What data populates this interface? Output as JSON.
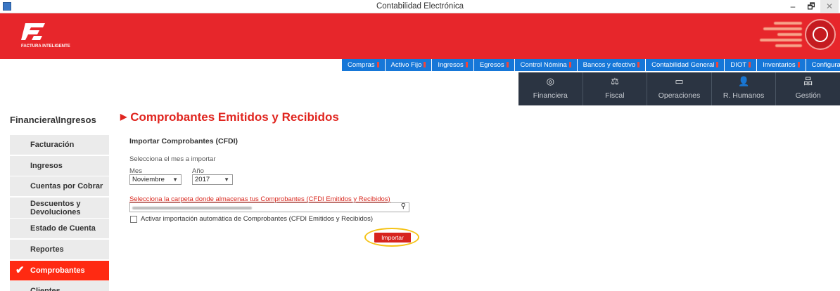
{
  "window": {
    "title": "Contabilidad Electrónica",
    "minimize": "–",
    "maximize": "🗗",
    "close": "✕"
  },
  "brand": {
    "logo_text": "FACTURA INTELIGENTE"
  },
  "topnav": [
    {
      "label": "Compras",
      "pinned": true
    },
    {
      "label": "Activo Fijo",
      "pinned": true
    },
    {
      "label": "Ingresos",
      "pinned": true
    },
    {
      "label": "Egresos",
      "pinned": true
    },
    {
      "label": "Control Nómina",
      "pinned": true
    },
    {
      "label": "Bancos y efectivo",
      "pinned": true
    },
    {
      "label": "Contabilidad General",
      "pinned": true
    },
    {
      "label": "DIOT",
      "pinned": true
    },
    {
      "label": "Inventarios",
      "pinned": true
    },
    {
      "label": "Configuración",
      "pinned": false
    }
  ],
  "modules": [
    {
      "label": "Financiera",
      "icon": "coins-icon",
      "glyph": "◎"
    },
    {
      "label": "Fiscal",
      "icon": "scales-icon",
      "glyph": "⚖"
    },
    {
      "label": "Operaciones",
      "icon": "monitor-icon",
      "glyph": "▭"
    },
    {
      "label": "R. Humanos",
      "icon": "person-icon",
      "glyph": "👤"
    },
    {
      "label": "Gestión",
      "icon": "org-chart-icon",
      "glyph": "品"
    }
  ],
  "breadcrumb": "Financiera\\Ingresos",
  "sidebar": [
    {
      "label": "Facturación"
    },
    {
      "label": "Ingresos"
    },
    {
      "label": "Cuentas por Cobrar"
    },
    {
      "label": "Descuentos y Devoluciones"
    },
    {
      "label": "Estado de Cuenta"
    },
    {
      "label": "Reportes"
    },
    {
      "label": "Comprobantes",
      "active": true
    },
    {
      "label": "Clientes"
    }
  ],
  "main": {
    "title": "Comprobantes Emitidos y Recibidos",
    "section_title": "Importar Comprobantes (CFDI)",
    "month_prompt": "Selecciona el mes a importar",
    "mes_label": "Mes",
    "anio_label": "Año",
    "mes_value": "Noviembre",
    "anio_value": "2017",
    "folder_label": "Selecciona la carpeta donde almacenas tus Comprobantes (CFDI Emitidos y Recibidos)",
    "auto_import_label": "Activar importación automática de Comprobantes (CFDI Emitidos y Recibidos)",
    "import_button": "Importar"
  },
  "colors": {
    "brand_red": "#e7262b",
    "nav_blue": "#1677d8",
    "module_dark": "#2b3442",
    "highlight": "#f5c316"
  }
}
